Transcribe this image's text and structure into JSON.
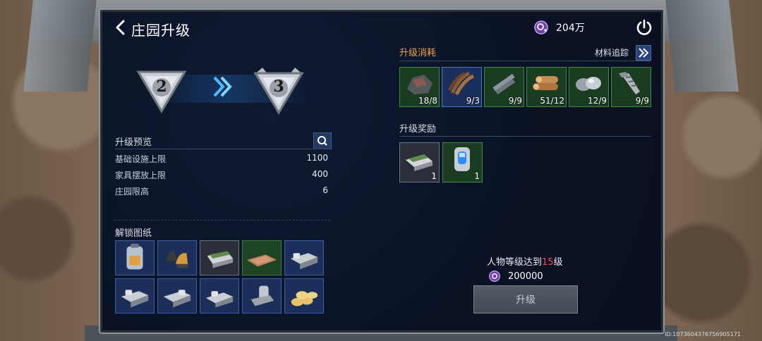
{
  "header": {
    "title": "庄园升级",
    "currency_value": "204万"
  },
  "ranks": {
    "current": "2",
    "next": "3"
  },
  "preview": {
    "title": "升级预览",
    "stats": [
      {
        "label": "基础设施上限",
        "value": "1100"
      },
      {
        "label": "家具摆放上限",
        "value": "400"
      },
      {
        "label": "庄园限高",
        "value": "6"
      }
    ]
  },
  "blueprints": {
    "title": "解锁图纸",
    "items": [
      {
        "icon": "backpack-icon",
        "rarity": "blue"
      },
      {
        "icon": "gloves-icon",
        "rarity": "blue"
      },
      {
        "icon": "planter-icon",
        "rarity": "gray"
      },
      {
        "icon": "rug-icon",
        "rarity": "green"
      },
      {
        "icon": "sofa-icon",
        "rarity": "blue"
      },
      {
        "icon": "sofa-icon",
        "rarity": "blue"
      },
      {
        "icon": "sofa-icon",
        "rarity": "blue"
      },
      {
        "icon": "sofa-icon",
        "rarity": "blue"
      },
      {
        "icon": "armchair-icon",
        "rarity": "blue"
      },
      {
        "icon": "sandbags-icon",
        "rarity": "blue"
      }
    ]
  },
  "cost": {
    "title": "升级消耗",
    "track_label": "材料追踪",
    "materials": [
      {
        "icon": "ore-icon",
        "count": "18/8",
        "rarity": "green"
      },
      {
        "icon": "wood-strips-icon",
        "count": "9/3",
        "rarity": "blue"
      },
      {
        "icon": "metal-parts-icon",
        "count": "9/9",
        "rarity": "green"
      },
      {
        "icon": "logs-icon",
        "count": "51/12",
        "rarity": "green"
      },
      {
        "icon": "glass-icon",
        "count": "12/9",
        "rarity": "green"
      },
      {
        "icon": "screw-icon",
        "count": "9/9",
        "rarity": "green"
      }
    ]
  },
  "rewards": {
    "title": "升级奖励",
    "items": [
      {
        "icon": "planter-icon",
        "count": "1",
        "rarity": "gray"
      },
      {
        "icon": "capsule-icon",
        "count": "1",
        "rarity": "green"
      }
    ]
  },
  "requirement": {
    "prefix": "人物等级达到",
    "level": "15",
    "suffix": "级",
    "cost_value": "200000"
  },
  "upgrade_label": "升级",
  "footer_id": "ID:1073604376756905171",
  "colors": {
    "accent_orange": "#f0a14d",
    "highlight_red": "#ff4a4a",
    "panel_bg": "#0c1426"
  }
}
